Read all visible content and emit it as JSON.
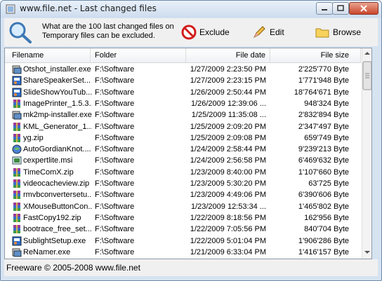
{
  "window": {
    "title": "www.file.net - Last changed files"
  },
  "toolbar": {
    "query_line1": "What are the 100 last changed files on y",
    "query_line2": "Temporary files can be excluded.",
    "exclude_label": "Exclude",
    "edit_label": "Edit",
    "browse_label": "Browse"
  },
  "table": {
    "columns": {
      "filename": "Filename",
      "folder": "Folder",
      "date": "File date",
      "size": "File size"
    },
    "rows": [
      {
        "name": "Otshot_installer.exe",
        "folder": "F:\\Software",
        "date": "1/27/2009 2:23:50 PM",
        "size": "2'225'770 Byte",
        "icon": "installer"
      },
      {
        "name": "ShareSpeakerSet...",
        "folder": "F:\\Software",
        "date": "1/27/2009 2:23:15 PM",
        "size": "1'771'948 Byte",
        "icon": "setup"
      },
      {
        "name": "SlideShowYouTub...",
        "folder": "F:\\Software",
        "date": "1/26/2009 2:50:44 PM",
        "size": "18'764'671 Byte",
        "icon": "setup"
      },
      {
        "name": "ImagePrinter_1.5.3...",
        "folder": "F:\\Software",
        "date": "1/26/2009 12:39:06 ...",
        "size": "948'324 Byte",
        "icon": "archive"
      },
      {
        "name": "mk2mp-installer.exe",
        "folder": "F:\\Software",
        "date": "1/25/2009 11:35:08 ...",
        "size": "2'832'894 Byte",
        "icon": "installer"
      },
      {
        "name": "KML_Generator_1...",
        "folder": "F:\\Software",
        "date": "1/25/2009 2:09:20 PM",
        "size": "2'347'497 Byte",
        "icon": "archive"
      },
      {
        "name": "yg.zip",
        "folder": "F:\\Software",
        "date": "1/25/2009 2:09:08 PM",
        "size": "659'749 Byte",
        "icon": "archive"
      },
      {
        "name": "AutoGordianKnot....",
        "folder": "F:\\Software",
        "date": "1/24/2009 2:58:44 PM",
        "size": "9'239'213 Byte",
        "icon": "globe"
      },
      {
        "name": "cexpertlite.msi",
        "folder": "F:\\Software",
        "date": "1/24/2009 2:56:58 PM",
        "size": "6'469'632 Byte",
        "icon": "msi"
      },
      {
        "name": "TimeComX.zip",
        "folder": "F:\\Software",
        "date": "1/23/2009 8:40:00 PM",
        "size": "1'107'660 Byte",
        "icon": "archive"
      },
      {
        "name": "videocacheview.zip",
        "folder": "F:\\Software",
        "date": "1/23/2009 5:30:20 PM",
        "size": "63'725 Byte",
        "icon": "archive"
      },
      {
        "name": "rmvbconvertersetu...",
        "folder": "F:\\Software",
        "date": "1/23/2009 4:49:06 PM",
        "size": "6'390'606 Byte",
        "icon": "archive"
      },
      {
        "name": "XMouseButtonCon...",
        "folder": "F:\\Software",
        "date": "1/23/2009 12:53:34 ...",
        "size": "1'465'802 Byte",
        "icon": "archive"
      },
      {
        "name": "FastCopy192.zip",
        "folder": "F:\\Software",
        "date": "1/22/2009 8:18:56 PM",
        "size": "162'956 Byte",
        "icon": "archive"
      },
      {
        "name": "bootrace_free_set...",
        "folder": "F:\\Software",
        "date": "1/22/2009 7:05:56 PM",
        "size": "840'704 Byte",
        "icon": "archive"
      },
      {
        "name": "SublightSetup.exe",
        "folder": "F:\\Software",
        "date": "1/22/2009 5:01:04 PM",
        "size": "1'906'286 Byte",
        "icon": "setup"
      },
      {
        "name": "ReNamer.exe",
        "folder": "F:\\Software",
        "date": "1/21/2009 6:33:04 PM",
        "size": "1'416'157 Byte",
        "icon": "installer"
      }
    ]
  },
  "status": {
    "text": "Freeware © 2005-2008 www.file.net"
  },
  "colors": {
    "title_bar": "#cddcee",
    "window_frame": "#d6e3f1",
    "close_button": "#c9452c"
  }
}
